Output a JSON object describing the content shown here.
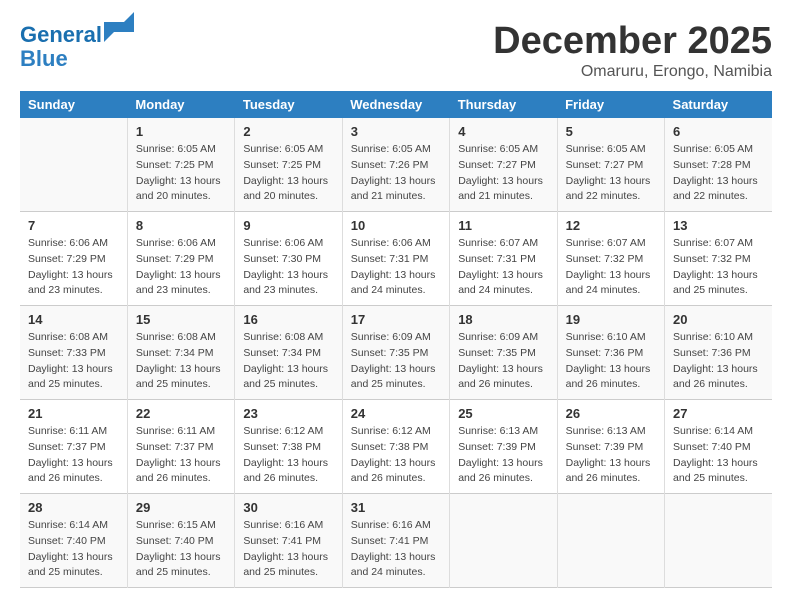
{
  "logo": {
    "line1": "General",
    "line2": "Blue"
  },
  "title": "December 2025",
  "location": "Omaruru, Erongo, Namibia",
  "days_of_week": [
    "Sunday",
    "Monday",
    "Tuesday",
    "Wednesday",
    "Thursday",
    "Friday",
    "Saturday"
  ],
  "weeks": [
    [
      {
        "day": "",
        "sunrise": "",
        "sunset": "",
        "daylight": ""
      },
      {
        "day": "1",
        "sunrise": "Sunrise: 6:05 AM",
        "sunset": "Sunset: 7:25 PM",
        "daylight": "Daylight: 13 hours and 20 minutes."
      },
      {
        "day": "2",
        "sunrise": "Sunrise: 6:05 AM",
        "sunset": "Sunset: 7:25 PM",
        "daylight": "Daylight: 13 hours and 20 minutes."
      },
      {
        "day": "3",
        "sunrise": "Sunrise: 6:05 AM",
        "sunset": "Sunset: 7:26 PM",
        "daylight": "Daylight: 13 hours and 21 minutes."
      },
      {
        "day": "4",
        "sunrise": "Sunrise: 6:05 AM",
        "sunset": "Sunset: 7:27 PM",
        "daylight": "Daylight: 13 hours and 21 minutes."
      },
      {
        "day": "5",
        "sunrise": "Sunrise: 6:05 AM",
        "sunset": "Sunset: 7:27 PM",
        "daylight": "Daylight: 13 hours and 22 minutes."
      },
      {
        "day": "6",
        "sunrise": "Sunrise: 6:05 AM",
        "sunset": "Sunset: 7:28 PM",
        "daylight": "Daylight: 13 hours and 22 minutes."
      }
    ],
    [
      {
        "day": "7",
        "sunrise": "Sunrise: 6:06 AM",
        "sunset": "Sunset: 7:29 PM",
        "daylight": "Daylight: 13 hours and 23 minutes."
      },
      {
        "day": "8",
        "sunrise": "Sunrise: 6:06 AM",
        "sunset": "Sunset: 7:29 PM",
        "daylight": "Daylight: 13 hours and 23 minutes."
      },
      {
        "day": "9",
        "sunrise": "Sunrise: 6:06 AM",
        "sunset": "Sunset: 7:30 PM",
        "daylight": "Daylight: 13 hours and 23 minutes."
      },
      {
        "day": "10",
        "sunrise": "Sunrise: 6:06 AM",
        "sunset": "Sunset: 7:31 PM",
        "daylight": "Daylight: 13 hours and 24 minutes."
      },
      {
        "day": "11",
        "sunrise": "Sunrise: 6:07 AM",
        "sunset": "Sunset: 7:31 PM",
        "daylight": "Daylight: 13 hours and 24 minutes."
      },
      {
        "day": "12",
        "sunrise": "Sunrise: 6:07 AM",
        "sunset": "Sunset: 7:32 PM",
        "daylight": "Daylight: 13 hours and 24 minutes."
      },
      {
        "day": "13",
        "sunrise": "Sunrise: 6:07 AM",
        "sunset": "Sunset: 7:32 PM",
        "daylight": "Daylight: 13 hours and 25 minutes."
      }
    ],
    [
      {
        "day": "14",
        "sunrise": "Sunrise: 6:08 AM",
        "sunset": "Sunset: 7:33 PM",
        "daylight": "Daylight: 13 hours and 25 minutes."
      },
      {
        "day": "15",
        "sunrise": "Sunrise: 6:08 AM",
        "sunset": "Sunset: 7:34 PM",
        "daylight": "Daylight: 13 hours and 25 minutes."
      },
      {
        "day": "16",
        "sunrise": "Sunrise: 6:08 AM",
        "sunset": "Sunset: 7:34 PM",
        "daylight": "Daylight: 13 hours and 25 minutes."
      },
      {
        "day": "17",
        "sunrise": "Sunrise: 6:09 AM",
        "sunset": "Sunset: 7:35 PM",
        "daylight": "Daylight: 13 hours and 25 minutes."
      },
      {
        "day": "18",
        "sunrise": "Sunrise: 6:09 AM",
        "sunset": "Sunset: 7:35 PM",
        "daylight": "Daylight: 13 hours and 26 minutes."
      },
      {
        "day": "19",
        "sunrise": "Sunrise: 6:10 AM",
        "sunset": "Sunset: 7:36 PM",
        "daylight": "Daylight: 13 hours and 26 minutes."
      },
      {
        "day": "20",
        "sunrise": "Sunrise: 6:10 AM",
        "sunset": "Sunset: 7:36 PM",
        "daylight": "Daylight: 13 hours and 26 minutes."
      }
    ],
    [
      {
        "day": "21",
        "sunrise": "Sunrise: 6:11 AM",
        "sunset": "Sunset: 7:37 PM",
        "daylight": "Daylight: 13 hours and 26 minutes."
      },
      {
        "day": "22",
        "sunrise": "Sunrise: 6:11 AM",
        "sunset": "Sunset: 7:37 PM",
        "daylight": "Daylight: 13 hours and 26 minutes."
      },
      {
        "day": "23",
        "sunrise": "Sunrise: 6:12 AM",
        "sunset": "Sunset: 7:38 PM",
        "daylight": "Daylight: 13 hours and 26 minutes."
      },
      {
        "day": "24",
        "sunrise": "Sunrise: 6:12 AM",
        "sunset": "Sunset: 7:38 PM",
        "daylight": "Daylight: 13 hours and 26 minutes."
      },
      {
        "day": "25",
        "sunrise": "Sunrise: 6:13 AM",
        "sunset": "Sunset: 7:39 PM",
        "daylight": "Daylight: 13 hours and 26 minutes."
      },
      {
        "day": "26",
        "sunrise": "Sunrise: 6:13 AM",
        "sunset": "Sunset: 7:39 PM",
        "daylight": "Daylight: 13 hours and 26 minutes."
      },
      {
        "day": "27",
        "sunrise": "Sunrise: 6:14 AM",
        "sunset": "Sunset: 7:40 PM",
        "daylight": "Daylight: 13 hours and 25 minutes."
      }
    ],
    [
      {
        "day": "28",
        "sunrise": "Sunrise: 6:14 AM",
        "sunset": "Sunset: 7:40 PM",
        "daylight": "Daylight: 13 hours and 25 minutes."
      },
      {
        "day": "29",
        "sunrise": "Sunrise: 6:15 AM",
        "sunset": "Sunset: 7:40 PM",
        "daylight": "Daylight: 13 hours and 25 minutes."
      },
      {
        "day": "30",
        "sunrise": "Sunrise: 6:16 AM",
        "sunset": "Sunset: 7:41 PM",
        "daylight": "Daylight: 13 hours and 25 minutes."
      },
      {
        "day": "31",
        "sunrise": "Sunrise: 6:16 AM",
        "sunset": "Sunset: 7:41 PM",
        "daylight": "Daylight: 13 hours and 24 minutes."
      },
      {
        "day": "",
        "sunrise": "",
        "sunset": "",
        "daylight": ""
      },
      {
        "day": "",
        "sunrise": "",
        "sunset": "",
        "daylight": ""
      },
      {
        "day": "",
        "sunrise": "",
        "sunset": "",
        "daylight": ""
      }
    ]
  ]
}
